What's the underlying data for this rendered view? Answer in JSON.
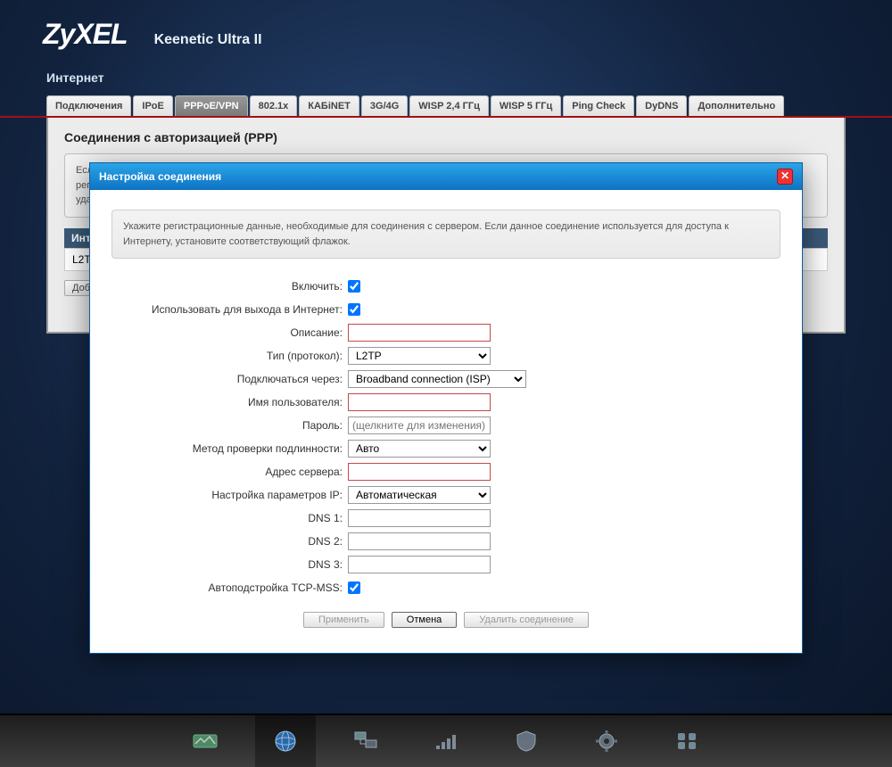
{
  "header": {
    "logo": "ZyXEL",
    "model": "Keenetic Ultra II"
  },
  "page": {
    "title": "Интернет"
  },
  "tabs": [
    "Подключения",
    "IPoE",
    "PPPoE/VPN",
    "802.1x",
    "КАБiNET",
    "3G/4G",
    "WISP 2,4 ГГц",
    "WISP 5 ГГц",
    "Ping Check",
    "DyDNS",
    "Дополнительно"
  ],
  "active_tab_index": 2,
  "panel": {
    "title": "Соединения с авторизацией (PPP)",
    "hint_lines": [
      "Если",
      "рег",
      "уда"
    ],
    "table_header_partial": "Инт",
    "row0_partial": "L2TP",
    "add_btn_partial": "Доб"
  },
  "modal": {
    "title": "Настройка соединения",
    "hint": "Укажите регистрационные данные, необходимые для соединения с сервером. Если данное соединение используется для доступа к Интернету, установите соответствующий флажок.",
    "labels": {
      "enable": "Включить:",
      "use_for_internet": "Использовать для выхода в Интернет:",
      "description": "Описание:",
      "protocol": "Тип (протокол):",
      "connect_via": "Подключаться через:",
      "username": "Имя пользователя:",
      "password": "Пароль:",
      "auth_method": "Метод проверки подлинности:",
      "server": "Адрес сервера:",
      "ip_params": "Настройка параметров IP:",
      "dns1": "DNS 1:",
      "dns2": "DNS 2:",
      "dns3": "DNS 3:",
      "tcp_mss": "Автоподстройка TCP-MSS:"
    },
    "values": {
      "enable": true,
      "use_for_internet": true,
      "description": "",
      "protocol": "L2TP",
      "connect_via": "Broadband connection (ISP)",
      "username": "",
      "password_placeholder": "(щелкните для изменения)",
      "auth_method": "Авто",
      "server": "",
      "ip_params": "Автоматическая",
      "dns1": "",
      "dns2": "",
      "dns3": "",
      "tcp_mss": true
    },
    "buttons": {
      "apply": "Применить",
      "cancel": "Отмена",
      "delete": "Удалить соединение"
    }
  },
  "bottombar": {
    "items": [
      "status-icon",
      "globe-icon",
      "network-icon",
      "signal-icon",
      "shield-icon",
      "gear-icon",
      "apps-icon"
    ],
    "active_index": 1
  }
}
